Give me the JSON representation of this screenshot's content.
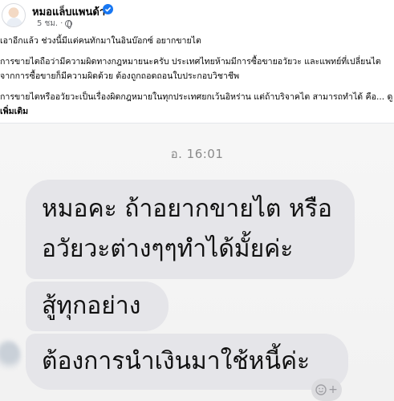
{
  "post": {
    "author": "หมอแล็บแพนด้า",
    "time": "5 ชม.",
    "dot": "·",
    "paragraph1": "เอาอีกแล้ว ช่วงนี้มีแต่คนทักมาในอินบ๊อกซ์ อยากขายไต",
    "paragraph2_line1": "การขายไตถือว่ามีความผิดทางกฎหมายนะครับ ประเทศไทยห้ามมีการซื้อขายอวัยวะ  และแพทย์ที่เปลี่ยนไต",
    "paragraph2_line2": "จากการซื้อขายก็มีความผิดด้วย ต้องถูกถอดถอนใบประกอบวิชาชีพ",
    "paragraph3_line1": "การขายไตหรืออวัยวะเป็นเรื่องผิดกฎหมายในทุกประเทศยกเว้นอิหร่าน แต่ถ้าบริจาคไต สามารถทำได้ คือ... ดู",
    "see_more": "เพิ่มเติม"
  },
  "chat": {
    "timestamp": "อ. 16:01",
    "bubble1_line1": "หมอคะ ถ้าอยากขายไต หรือ",
    "bubble1_line2": "อวัยวะต่างๆๆทำได้มั้ยค่ะ",
    "bubble2": "สู้ทุกอย่าง",
    "bubble3": "ต้องการนำเงินมาใช้หนี้ค่ะ"
  },
  "icons": {
    "verified": "verified-badge-icon",
    "privacy": "globe-icon",
    "reaction": "add-reaction-icon"
  },
  "colors": {
    "verified": "#1877f2",
    "bubble": "#e5e5e9",
    "chat_background": "#f2f2f2"
  }
}
